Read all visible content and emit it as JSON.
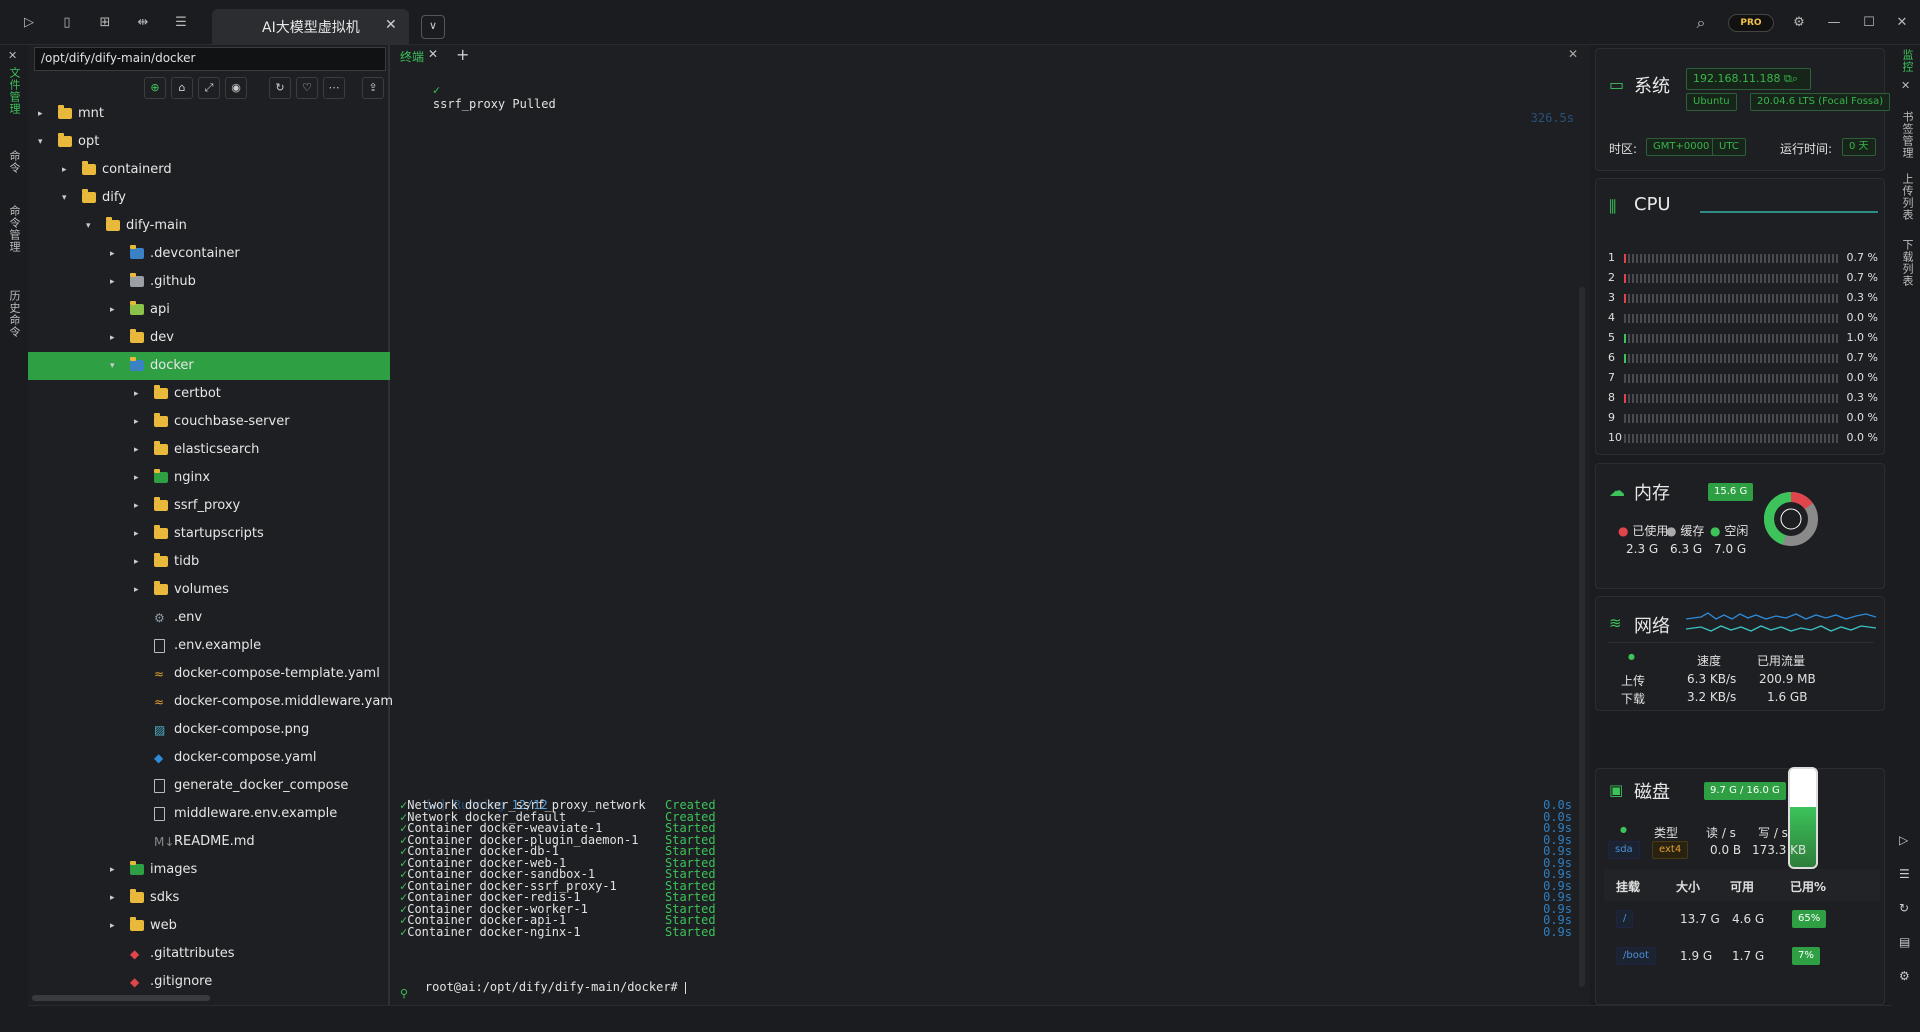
{
  "window": {
    "tab_title": "AI大模型虚拟机",
    "tab_close": "✕",
    "tab_dropdown": "∨",
    "pro_badge": "PRO",
    "icons": [
      "sidebar-toggle-icon",
      "bookmark-icon",
      "grid-icon",
      "layers-icon",
      "list-icon"
    ],
    "controls": [
      "search-icon",
      "settings-icon",
      "minimize-icon",
      "maximize-icon",
      "close-icon"
    ]
  },
  "left_strip": {
    "close": "✕",
    "items": [
      "文件管理",
      "命令",
      "命令管理",
      "历史命令"
    ]
  },
  "file_panel": {
    "path": "/opt/dify/dify-main/docker",
    "toolbar": [
      "locate-icon",
      "home-icon",
      "expand-icon",
      "eye-icon",
      "refresh-icon",
      "favorite-icon",
      "more-icon",
      "upload-icon"
    ],
    "tree": [
      {
        "name": "mnt",
        "level": 0,
        "kind": "folder",
        "caret": "▸"
      },
      {
        "name": "opt",
        "level": 0,
        "kind": "folder",
        "caret": "▾"
      },
      {
        "name": "containerd",
        "level": 1,
        "kind": "folder",
        "caret": "▸"
      },
      {
        "name": "dify",
        "level": 1,
        "kind": "folder",
        "caret": "▾"
      },
      {
        "name": "dify-main",
        "level": 2,
        "kind": "folder",
        "caret": "▾"
      },
      {
        "name": ".devcontainer",
        "level": 3,
        "kind": "folder-special",
        "caret": "▸",
        "color": "#3b82c4"
      },
      {
        "name": ".github",
        "level": 3,
        "kind": "folder-special",
        "caret": "▸",
        "color": "#9aa0a6"
      },
      {
        "name": "api",
        "level": 3,
        "kind": "folder-special",
        "caret": "▸",
        "color": "#8bc34a"
      },
      {
        "name": "dev",
        "level": 3,
        "kind": "folder",
        "caret": "▸"
      },
      {
        "name": "docker",
        "level": 3,
        "kind": "folder-special",
        "caret": "▾",
        "color": "#3b82c4",
        "selected": true
      },
      {
        "name": "certbot",
        "level": 4,
        "kind": "folder",
        "caret": "▸"
      },
      {
        "name": "couchbase-server",
        "level": 4,
        "kind": "folder",
        "caret": "▸"
      },
      {
        "name": "elasticsearch",
        "level": 4,
        "kind": "folder",
        "caret": "▸"
      },
      {
        "name": "nginx",
        "level": 4,
        "kind": "folder-special",
        "caret": "▸",
        "color": "#2ea043"
      },
      {
        "name": "ssrf_proxy",
        "level": 4,
        "kind": "folder",
        "caret": "▸"
      },
      {
        "name": "startupscripts",
        "level": 4,
        "kind": "folder",
        "caret": "▸"
      },
      {
        "name": "tidb",
        "level": 4,
        "kind": "folder",
        "caret": "▸"
      },
      {
        "name": "volumes",
        "level": 4,
        "kind": "folder",
        "caret": "▸"
      },
      {
        "name": ".env",
        "level": 4,
        "kind": "gear",
        "caret": ""
      },
      {
        "name": ".env.example",
        "level": 4,
        "kind": "file",
        "caret": ""
      },
      {
        "name": "docker-compose-template.yaml",
        "level": 4,
        "kind": "yaml",
        "caret": ""
      },
      {
        "name": "docker-compose.middleware.yaml",
        "level": 4,
        "kind": "yaml",
        "caret": ""
      },
      {
        "name": "docker-compose.png",
        "level": 4,
        "kind": "image",
        "caret": ""
      },
      {
        "name": "docker-compose.yaml",
        "level": 4,
        "kind": "docker",
        "caret": ""
      },
      {
        "name": "generate_docker_compose",
        "level": 4,
        "kind": "file",
        "caret": ""
      },
      {
        "name": "middleware.env.example",
        "level": 4,
        "kind": "file",
        "caret": ""
      },
      {
        "name": "README.md",
        "level": 4,
        "kind": "md",
        "caret": ""
      },
      {
        "name": "images",
        "level": 3,
        "kind": "folder-special",
        "caret": "▸",
        "color": "#2ea043"
      },
      {
        "name": "sdks",
        "level": 3,
        "kind": "folder",
        "caret": "▸"
      },
      {
        "name": "web",
        "level": 3,
        "kind": "folder",
        "caret": "▸"
      },
      {
        "name": ".gitattributes",
        "level": 3,
        "kind": "git",
        "caret": ""
      },
      {
        "name": ".gitignore",
        "level": 3,
        "kind": "git",
        "caret": ""
      }
    ]
  },
  "terminal": {
    "tab_label": "终端",
    "tab_close": "✕",
    "add": "+",
    "close": "✕",
    "top_line": {
      "check": "✓",
      "text": "ssrf_proxy Pulled",
      "time": "326.5s"
    },
    "running": {
      "prefix": "[+] Running ",
      "count": "12/12"
    },
    "lines": [
      {
        "text": "Network docker_ssrf_proxy_network",
        "status": "Created",
        "time": "0.0s"
      },
      {
        "text": "Network docker_default",
        "status": "Created",
        "time": "0.0s"
      },
      {
        "text": "Container docker-weaviate-1",
        "status": "Started",
        "time": "0.9s"
      },
      {
        "text": "Container docker-plugin_daemon-1",
        "status": "Started",
        "time": "0.9s"
      },
      {
        "text": "Container docker-db-1",
        "status": "Started",
        "time": "0.9s"
      },
      {
        "text": "Container docker-web-1",
        "status": "Started",
        "time": "0.9s"
      },
      {
        "text": "Container docker-sandbox-1",
        "status": "Started",
        "time": "0.9s"
      },
      {
        "text": "Container docker-ssrf_proxy-1",
        "status": "Started",
        "time": "0.9s"
      },
      {
        "text": "Container docker-redis-1",
        "status": "Started",
        "time": "0.9s"
      },
      {
        "text": "Container docker-worker-1",
        "status": "Started",
        "time": "0.9s"
      },
      {
        "text": "Container docker-api-1",
        "status": "Started",
        "time": "0.9s"
      },
      {
        "text": "Container docker-nginx-1",
        "status": "Started",
        "time": "0.9s"
      }
    ],
    "prompt": "root@ai:/opt/dify/dify-main/docker# "
  },
  "system": {
    "title": "系统",
    "ip": "192.168.11.188",
    "os": "Ubuntu",
    "version": "20.04.6 LTS (Focal Fossa)",
    "tz_label": "时区:",
    "tz_offset": "GMT+0000",
    "tz_name": "UTC",
    "uptime_label": "运行时间:",
    "uptime": "0 天"
  },
  "cpu": {
    "title": "CPU",
    "cores": [
      {
        "id": "1",
        "value": "0.7 %",
        "pct": 0.7,
        "color": "#e0454b"
      },
      {
        "id": "2",
        "value": "0.7 %",
        "pct": 0.7,
        "color": "#e0454b"
      },
      {
        "id": "3",
        "value": "0.3 %",
        "pct": 0.3,
        "color": "#e0454b"
      },
      {
        "id": "4",
        "value": "0.0 %",
        "pct": 0.0,
        "color": "#4a4b50"
      },
      {
        "id": "5",
        "value": "1.0 %",
        "pct": 1.0,
        "color": "#3cc35a"
      },
      {
        "id": "6",
        "value": "0.7 %",
        "pct": 0.7,
        "color": "#3cc35a"
      },
      {
        "id": "7",
        "value": "0.0 %",
        "pct": 0.0,
        "color": "#4a4b50"
      },
      {
        "id": "8",
        "value": "0.3 %",
        "pct": 0.3,
        "color": "#e0454b"
      },
      {
        "id": "9",
        "value": "0.0 %",
        "pct": 0.0,
        "color": "#4a4b50"
      },
      {
        "id": "10",
        "value": "0.0 %",
        "pct": 0.0,
        "color": "#4a4b50"
      }
    ]
  },
  "memory": {
    "title": "内存",
    "total": "15.6 G",
    "used_label": "已使用",
    "used": "2.3 G",
    "used_fraction": 0.15,
    "cache_label": "缓存",
    "cache": "6.3 G",
    "cache_fraction": 0.4,
    "free_label": "空闲",
    "free": "7.0 G",
    "free_fraction": 0.45
  },
  "network": {
    "title": "网络",
    "speed_label": "速度",
    "traffic_label": "已用流量",
    "up_label": "上传",
    "up_speed": "6.3 KB/s",
    "up_total": "200.9 MB",
    "down_label": "下载",
    "down_speed": "3.2 KB/s",
    "down_total": "1.6 GB"
  },
  "disk": {
    "title": "磁盘",
    "usage": "9.7 G / 16.0 G",
    "usage_fraction": 0.61,
    "type_label": "类型",
    "read_label": "读 / s",
    "write_label": "写 / s",
    "device": "sda",
    "fs": "ext4",
    "read": "0.0 B",
    "write": "173.3 KB",
    "headers": [
      "挂载",
      "大小",
      "可用",
      "已用%"
    ],
    "mounts": [
      {
        "mount": "/",
        "size": "13.7 G",
        "avail": "4.6 G",
        "used": "65%"
      },
      {
        "mount": "/boot",
        "size": "1.9 G",
        "avail": "1.7 G",
        "used": "7%"
      }
    ]
  },
  "right_strip": {
    "close": "✕",
    "items": [
      "监控",
      "书签管理",
      "上传列表",
      "下载列表"
    ]
  }
}
